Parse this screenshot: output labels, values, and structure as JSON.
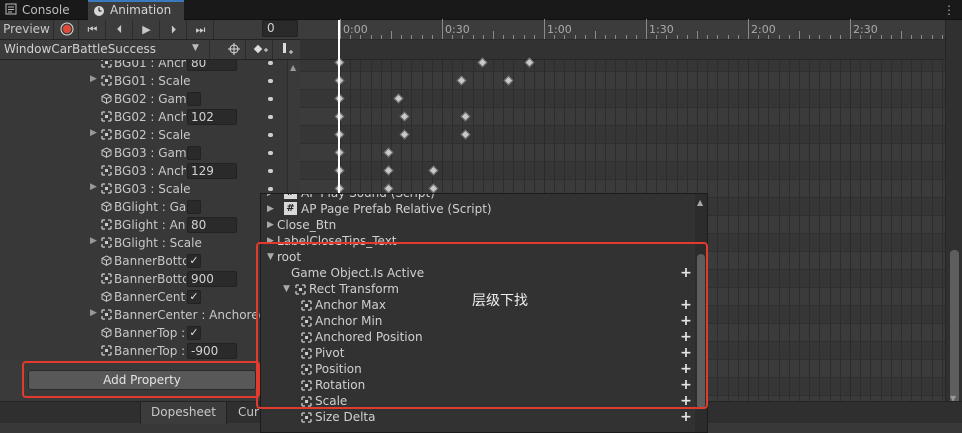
{
  "tabs": [
    {
      "label": "Console",
      "icon": "console-icon"
    },
    {
      "label": "Animation",
      "icon": "clock-icon"
    }
  ],
  "toolbar": {
    "preview_label": "Preview",
    "frame": "0",
    "clip_name": "WindowCarBattleSuccess"
  },
  "timeline": {
    "ticks": [
      "0:00",
      "0:30",
      "1:00",
      "1:30",
      "2:00",
      "2:30"
    ]
  },
  "properties": [
    {
      "label": "BG01 : Anch",
      "value": "80",
      "kind": "value",
      "icon": "rect-transform-icon",
      "expandable": false
    },
    {
      "label": "BG01 : Scale",
      "kind": "none",
      "icon": "rect-transform-icon",
      "expandable": true
    },
    {
      "label": "BG02 : Game",
      "kind": "check",
      "checked": false,
      "icon": "cube-icon",
      "expandable": false
    },
    {
      "label": "BG02 : Anch",
      "value": "102",
      "kind": "value",
      "icon": "rect-transform-icon",
      "expandable": false
    },
    {
      "label": "BG02 : Scale",
      "kind": "none",
      "icon": "rect-transform-icon",
      "expandable": true
    },
    {
      "label": "BG03 : Game",
      "kind": "check",
      "checked": false,
      "icon": "cube-icon",
      "expandable": false
    },
    {
      "label": "BG03 : Anch",
      "value": "129",
      "kind": "value",
      "icon": "rect-transform-icon",
      "expandable": false
    },
    {
      "label": "BG03 : Scale",
      "kind": "none",
      "icon": "rect-transform-icon",
      "expandable": true
    },
    {
      "label": "BGlight : Gar",
      "kind": "check",
      "checked": false,
      "icon": "cube-icon",
      "expandable": false
    },
    {
      "label": "BGlight : Anc",
      "value": "80",
      "kind": "value",
      "icon": "rect-transform-icon",
      "expandable": false
    },
    {
      "label": "BGlight : Scale",
      "kind": "none",
      "icon": "rect-transform-icon",
      "expandable": true
    },
    {
      "label": "BannerBotto",
      "kind": "check",
      "checked": true,
      "icon": "cube-icon",
      "expandable": false
    },
    {
      "label": "BannerBotto",
      "value": "900",
      "kind": "value",
      "icon": "rect-transform-icon",
      "expandable": false
    },
    {
      "label": "BannerCente",
      "kind": "check",
      "checked": true,
      "icon": "cube-icon",
      "expandable": false
    },
    {
      "label": "BannerCenter : Anchored",
      "kind": "none",
      "icon": "rect-transform-icon",
      "expandable": true
    },
    {
      "label": "BannerTop :",
      "kind": "check",
      "checked": true,
      "icon": "cube-icon",
      "expandable": false
    },
    {
      "label": "BannerTop :",
      "value": "-900",
      "kind": "value",
      "icon": "rect-transform-icon",
      "expandable": false
    }
  ],
  "keyframes": [
    [
      0.0,
      0.7,
      0.93
    ],
    [
      0.0,
      0.6,
      0.83
    ],
    [
      0.0,
      0.29
    ],
    [
      0.0,
      0.32,
      0.62
    ],
    [
      0.0,
      0.32,
      0.62
    ],
    [
      0.0,
      0.24
    ],
    [
      0.0,
      0.24,
      0.46
    ],
    [
      0.0,
      0.24,
      0.46
    ]
  ],
  "add_property_label": "Add Property",
  "bottom_tabs": [
    {
      "label": "Dopesheet",
      "active": true
    },
    {
      "label": "Cur",
      "active": false
    }
  ],
  "popup": {
    "rows": [
      {
        "label": "AP Play Sound (Script)",
        "type": "script",
        "indent": 0,
        "expand": "collapsed",
        "plus": false
      },
      {
        "label": "AP Page Prefab Relative (Script)",
        "type": "script",
        "indent": 0,
        "expand": "collapsed",
        "plus": false
      },
      {
        "label": "Close_Btn",
        "type": "object",
        "indent": 0,
        "expand": "collapsed",
        "plus": false
      },
      {
        "label": "LabelCloseTips_Text",
        "type": "object",
        "indent": 0,
        "expand": "collapsed",
        "plus": false
      },
      {
        "label": "root",
        "type": "object",
        "indent": 0,
        "expand": "expanded",
        "plus": false
      },
      {
        "label": "Game Object.Is Active",
        "type": "prop",
        "indent": 1,
        "expand": "none",
        "plus": true
      },
      {
        "label": "Rect Transform",
        "type": "rect",
        "indent": 1,
        "expand": "expanded",
        "plus": false
      },
      {
        "label": "Anchor Max",
        "type": "rect",
        "indent": 2,
        "expand": "none",
        "plus": true
      },
      {
        "label": "Anchor Min",
        "type": "rect",
        "indent": 2,
        "expand": "none",
        "plus": true
      },
      {
        "label": "Anchored Position",
        "type": "rect",
        "indent": 2,
        "expand": "none",
        "plus": true
      },
      {
        "label": "Pivot",
        "type": "rect",
        "indent": 2,
        "expand": "none",
        "plus": true
      },
      {
        "label": "Position",
        "type": "rect",
        "indent": 2,
        "expand": "none",
        "plus": true
      },
      {
        "label": "Rotation",
        "type": "rect",
        "indent": 2,
        "expand": "none",
        "plus": true
      },
      {
        "label": "Scale",
        "type": "rect",
        "indent": 2,
        "expand": "none",
        "plus": true
      },
      {
        "label": "Size Delta",
        "type": "rect",
        "indent": 2,
        "expand": "none",
        "plus": true
      }
    ]
  },
  "annotation": {
    "text": "层级下找",
    "color": "#e23b2e"
  }
}
